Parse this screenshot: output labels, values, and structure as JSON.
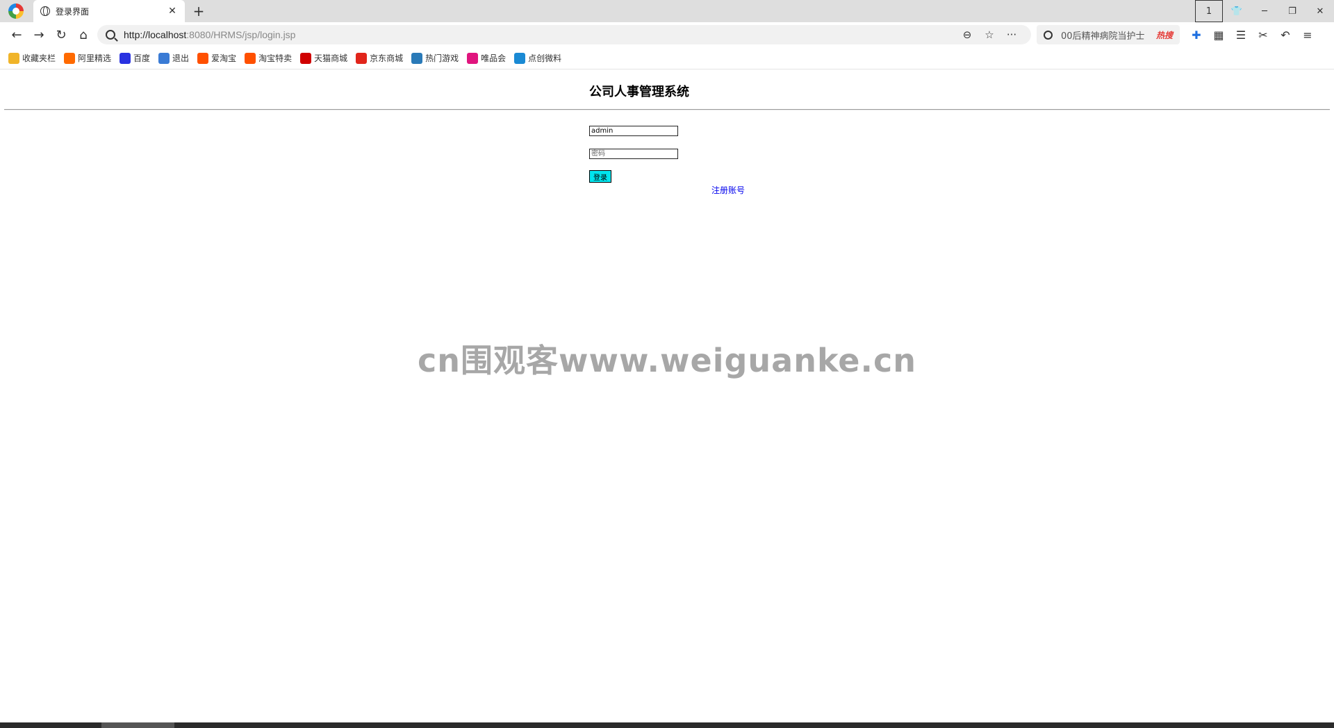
{
  "browser": {
    "tab_title": "登录界面",
    "tab_count": "1",
    "url_host": "http://localhost",
    "url_rest": ":8080/HRMS/jsp/login.jsp",
    "search_query": "00后精神病院当护士",
    "search_hot": "热搜"
  },
  "bookmarks": [
    {
      "label": "收藏夹栏",
      "icon": "folder-icon",
      "color": "#f0b429"
    },
    {
      "label": "阿里精选",
      "icon": "alibaba-icon",
      "color": "#ff6a00"
    },
    {
      "label": "百度",
      "icon": "baidu-paw-icon",
      "color": "#2932e1"
    },
    {
      "label": "退出",
      "icon": "feather-icon",
      "color": "#3a7bd5"
    },
    {
      "label": "爱淘宝",
      "icon": "taobao-icon",
      "color": "#ff5000"
    },
    {
      "label": "淘宝特卖",
      "icon": "taobao-icon",
      "color": "#ff5000"
    },
    {
      "label": "天猫商城",
      "icon": "tmall-icon",
      "color": "#d00000"
    },
    {
      "label": "京东商城",
      "icon": "jd-icon",
      "color": "#e1251b"
    },
    {
      "label": "热门游戏",
      "icon": "game-icon",
      "color": "#2a7ab8"
    },
    {
      "label": "唯品会",
      "icon": "vip-icon",
      "color": "#e0157e"
    },
    {
      "label": "点创微料",
      "icon": "dianchuang-icon",
      "color": "#1a8ad4"
    }
  ],
  "page": {
    "title": "公司人事管理系统",
    "username_value": "admin",
    "password_placeholder": "密码",
    "login_label": "登录",
    "register_label": "注册账号",
    "watermark": "cn围观客www.weiguanke.cn"
  }
}
